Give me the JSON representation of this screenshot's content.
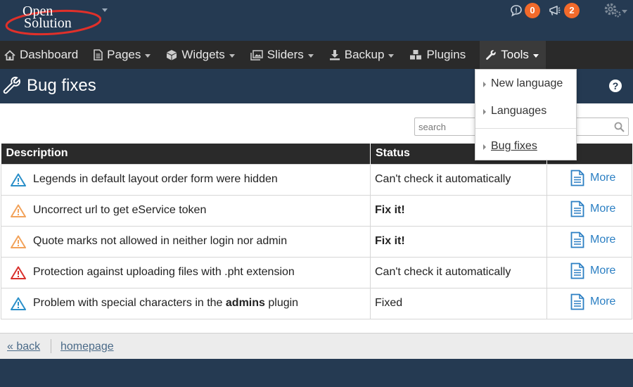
{
  "brand": {
    "line1": "Open",
    "line2": "Solution"
  },
  "notifications": {
    "messages_count": "0",
    "alerts_count": "2"
  },
  "nav": {
    "dashboard": "Dashboard",
    "pages": "Pages",
    "widgets": "Widgets",
    "sliders": "Sliders",
    "backup": "Backup",
    "plugins": "Plugins",
    "tools": "Tools"
  },
  "page": {
    "title": "Bug fixes",
    "help": "?"
  },
  "search": {
    "placeholder": "search"
  },
  "table": {
    "headers": {
      "description": "Description",
      "status": "Status"
    },
    "rows": [
      {
        "icon": "warning-icon-blue",
        "description": "Legends in default layout order form were hidden",
        "status": "Can't check it automatically",
        "more": "More"
      },
      {
        "icon": "warning-icon-orange",
        "description": "Uncorrect url to get eService token",
        "status": "Fix it!",
        "more": "More"
      },
      {
        "icon": "warning-icon-orange",
        "description": "Quote marks not allowed in neither login nor admin",
        "status": "Fix it!",
        "more": "More"
      },
      {
        "icon": "warning-icon-red",
        "description": "Protection against uploading files with .pht extension",
        "status": "Can't check it automatically",
        "more": "More"
      },
      {
        "icon": "warning-icon-blue",
        "description_pre": "Problem with special characters in the ",
        "description_bold": "admins",
        "description_post": " plugin",
        "status": "Fixed",
        "more": "More"
      }
    ]
  },
  "tools_menu": {
    "items": [
      "New language",
      "Languages",
      "Bug fixes"
    ]
  },
  "footer": {
    "back": "« back",
    "homepage": "homepage"
  },
  "colors": {
    "header_bg": "#253a52",
    "nav_bg": "#2a2a2a",
    "badge": "#f26a2b",
    "link": "#2b7fc3",
    "warn_blue": "#2a8fc9",
    "warn_orange": "#f2a25a",
    "warn_red": "#d9302c"
  }
}
